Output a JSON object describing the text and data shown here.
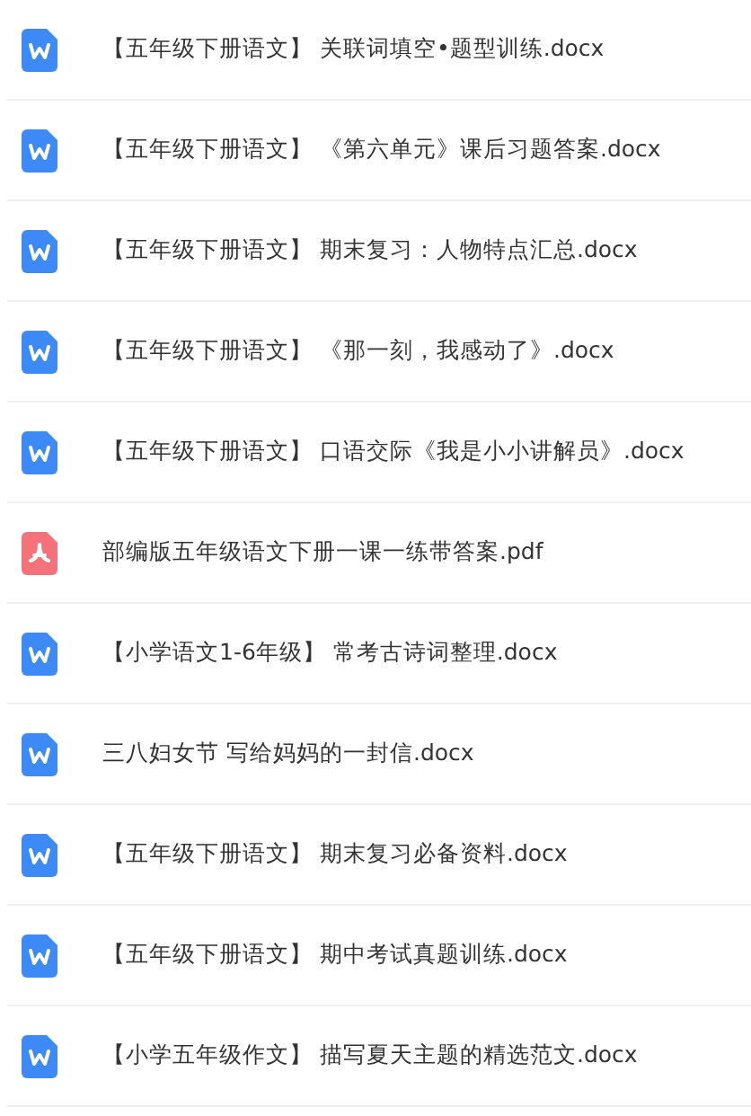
{
  "files": [
    {
      "kind": "word",
      "name": "【五年级下册语文】 关联词填空•题型训练.docx"
    },
    {
      "kind": "word",
      "name": "【五年级下册语文】 《第六单元》课后习题答案.docx"
    },
    {
      "kind": "word",
      "name": "【五年级下册语文】 期末复习：人物特点汇总.docx"
    },
    {
      "kind": "word",
      "name": "【五年级下册语文】 《那一刻，我感动了》.docx"
    },
    {
      "kind": "word",
      "name": "【五年级下册语文】 口语交际《我是小小讲解员》.docx"
    },
    {
      "kind": "pdf",
      "name": "部编版五年级语文下册一课一练带答案.pdf"
    },
    {
      "kind": "word",
      "name": "【小学语文1-6年级】 常考古诗词整理.docx"
    },
    {
      "kind": "word",
      "name": "三八妇女节 写给妈妈的一封信.docx"
    },
    {
      "kind": "word",
      "name": "【五年级下册语文】 期末复习必备资料.docx"
    },
    {
      "kind": "word",
      "name": "【五年级下册语文】 期中考试真题训练.docx"
    },
    {
      "kind": "word",
      "name": "【小学五年级作文】 描写夏天主题的精选范文.docx"
    }
  ]
}
